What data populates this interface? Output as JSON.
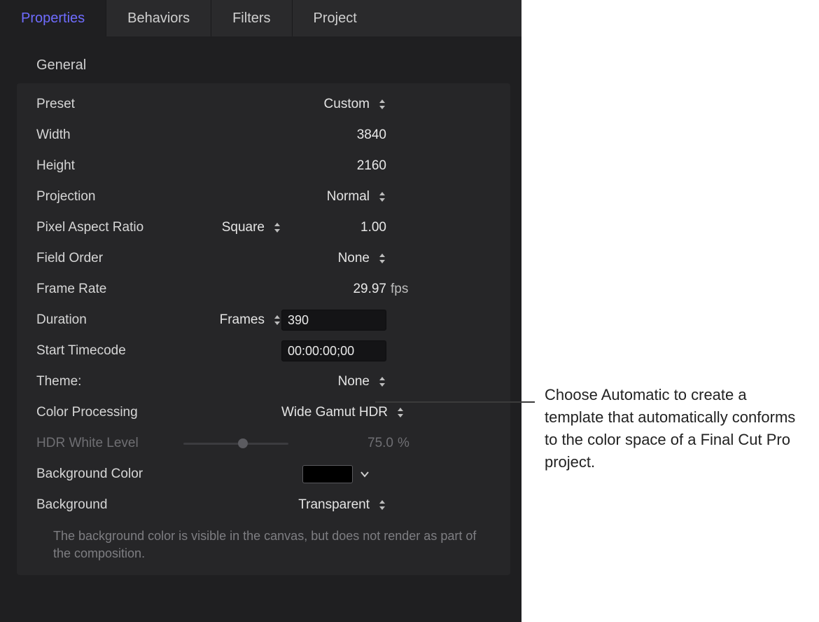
{
  "tabs": {
    "properties": "Properties",
    "behaviors": "Behaviors",
    "filters": "Filters",
    "project": "Project"
  },
  "section": {
    "general": "General"
  },
  "rows": {
    "preset": {
      "label": "Preset",
      "value": "Custom"
    },
    "width": {
      "label": "Width",
      "value": "3840"
    },
    "height": {
      "label": "Height",
      "value": "2160"
    },
    "projection": {
      "label": "Projection",
      "value": "Normal"
    },
    "par": {
      "label": "Pixel Aspect Ratio",
      "value": "Square",
      "num": "1.00"
    },
    "fieldorder": {
      "label": "Field Order",
      "value": "None"
    },
    "framerate": {
      "label": "Frame Rate",
      "value": "29.97",
      "suffix": "fps"
    },
    "duration": {
      "label": "Duration",
      "unit": "Frames",
      "value": "390"
    },
    "starttc": {
      "label": "Start Timecode",
      "value": "00:00:00;00"
    },
    "theme": {
      "label": "Theme:",
      "value": "None"
    },
    "colorproc": {
      "label": "Color Processing",
      "value": "Wide Gamut HDR"
    },
    "hdrwhite": {
      "label": "HDR White Level",
      "value": "75.0",
      "suffix": "%",
      "slider_pos": 0.55
    },
    "bgcolor": {
      "label": "Background Color",
      "swatch": "#000000"
    },
    "background": {
      "label": "Background",
      "value": "Transparent"
    }
  },
  "hint": "The background color is visible in the canvas, but does not render as part of the composition.",
  "callout": "Choose Automatic to create a template that automatically conforms to the color space of a Final Cut Pro project."
}
